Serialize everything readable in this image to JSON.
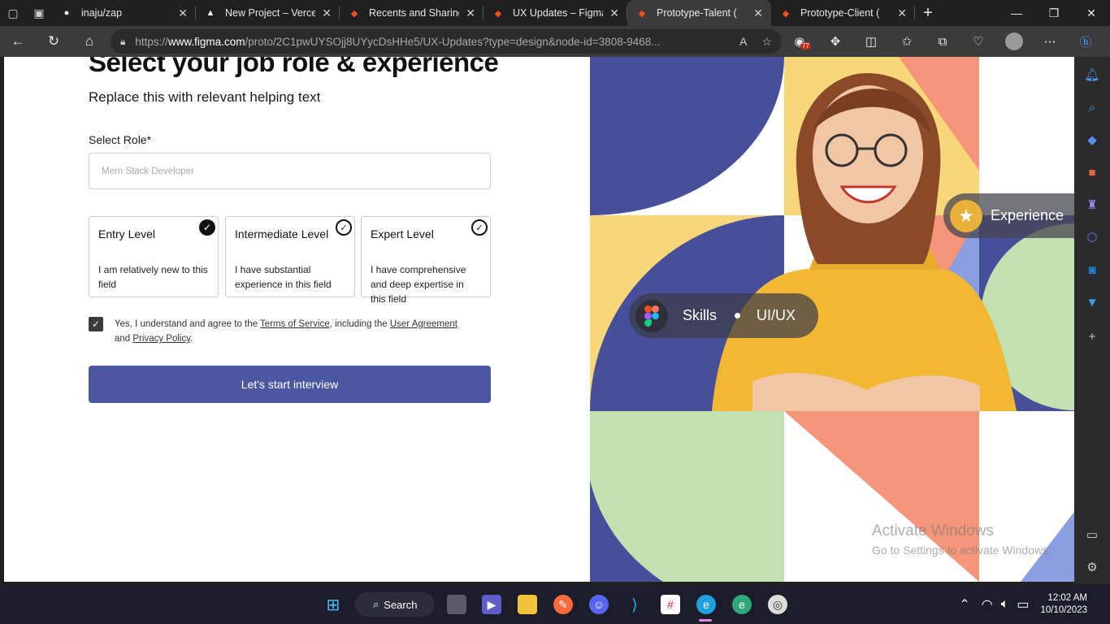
{
  "browser": {
    "tabs": [
      {
        "label": "inaju/zap",
        "icon": "github-icon",
        "active": false
      },
      {
        "label": "New Project – Vercel",
        "icon": "vercel-icon",
        "active": false
      },
      {
        "label": "Recents and Sharing",
        "icon": "figma-icon",
        "active": false
      },
      {
        "label": "UX Updates – Figma",
        "icon": "figma-icon",
        "active": false
      },
      {
        "label": "Prototype-Talent (",
        "icon": "figma-icon",
        "active": true
      },
      {
        "label": "Prototype-Client (",
        "icon": "figma-icon",
        "active": false
      }
    ],
    "url_prefix": "https://",
    "url_domain": "www.figma.com",
    "url_path": "/proto/2C1pwUYSOjj8UYycDsHHe5/UX-Updates?type=design&node-id=3808-9468...",
    "extension_badge": "77"
  },
  "form": {
    "title": "Select your job role & experience",
    "helper": "Replace this with relevant helping text",
    "role_label": "Select Role*",
    "role_value": "Mern Stack Developer",
    "levels": [
      {
        "name": "Entry Level",
        "desc": "I am relatively new to this field",
        "state": "checked"
      },
      {
        "name": "Intermediate Level",
        "desc": "I have substantial experience in this field",
        "state": "outline"
      },
      {
        "name": "Expert Level",
        "desc": "I have comprehensive and deep expertise in this field",
        "state": "outline"
      }
    ],
    "agree_prefix": "Yes, I understand and agree to the",
    "terms_link": "Terms of Service",
    "agree_mid": ", including the",
    "user_agreement_link": "User Agreement",
    "agree_and": "and",
    "privacy_link": "Privacy Policy",
    "agree_end": ".",
    "start_button": "Let's start interview"
  },
  "hero": {
    "skills_label": "Skills",
    "skills_value": "UI/UX",
    "experience_label": "Experience",
    "colors": {
      "navy": "#474f9b",
      "yellow": "#f8d67a",
      "salmon": "#f5967a",
      "green": "#c2e1b0",
      "lavender": "#8c9ee0"
    }
  },
  "watermark": {
    "line1": "Activate Windows",
    "line2": "Go to Settings to activate Windows."
  },
  "taskbar": {
    "search_label": "Search",
    "time": "12:02 AM",
    "date": "10/10/2023"
  }
}
